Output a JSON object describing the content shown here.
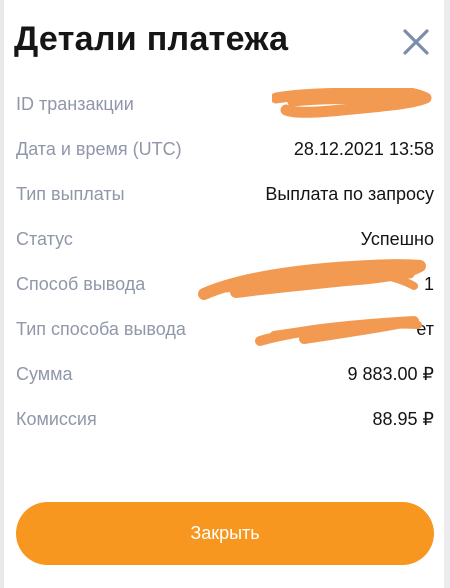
{
  "header": {
    "title": "Детали платежа",
    "close_icon": "close-icon"
  },
  "rows": [
    {
      "label": "ID транзакции",
      "value": "",
      "redacted": true
    },
    {
      "label": "Дата и время (UTC)",
      "value": "28.12.2021 13:58"
    },
    {
      "label": "Тип выплаты",
      "value": "Выплата по запросу"
    },
    {
      "label": "Статус",
      "value": "Успешно"
    },
    {
      "label": "Способ вывода",
      "value": "1",
      "redacted": true
    },
    {
      "label": "Тип способа вывода",
      "value": "ет",
      "redacted": true
    },
    {
      "label": "Сумма",
      "value": "9 883.00 ₽"
    },
    {
      "label": "Комиссия",
      "value": "88.95 ₽"
    }
  ],
  "button": {
    "label": "Закрыть"
  },
  "colors": {
    "accent": "#f7971f",
    "redaction": "#f39a52",
    "label": "#8f97a8",
    "close_icon": "#7b8cad"
  }
}
